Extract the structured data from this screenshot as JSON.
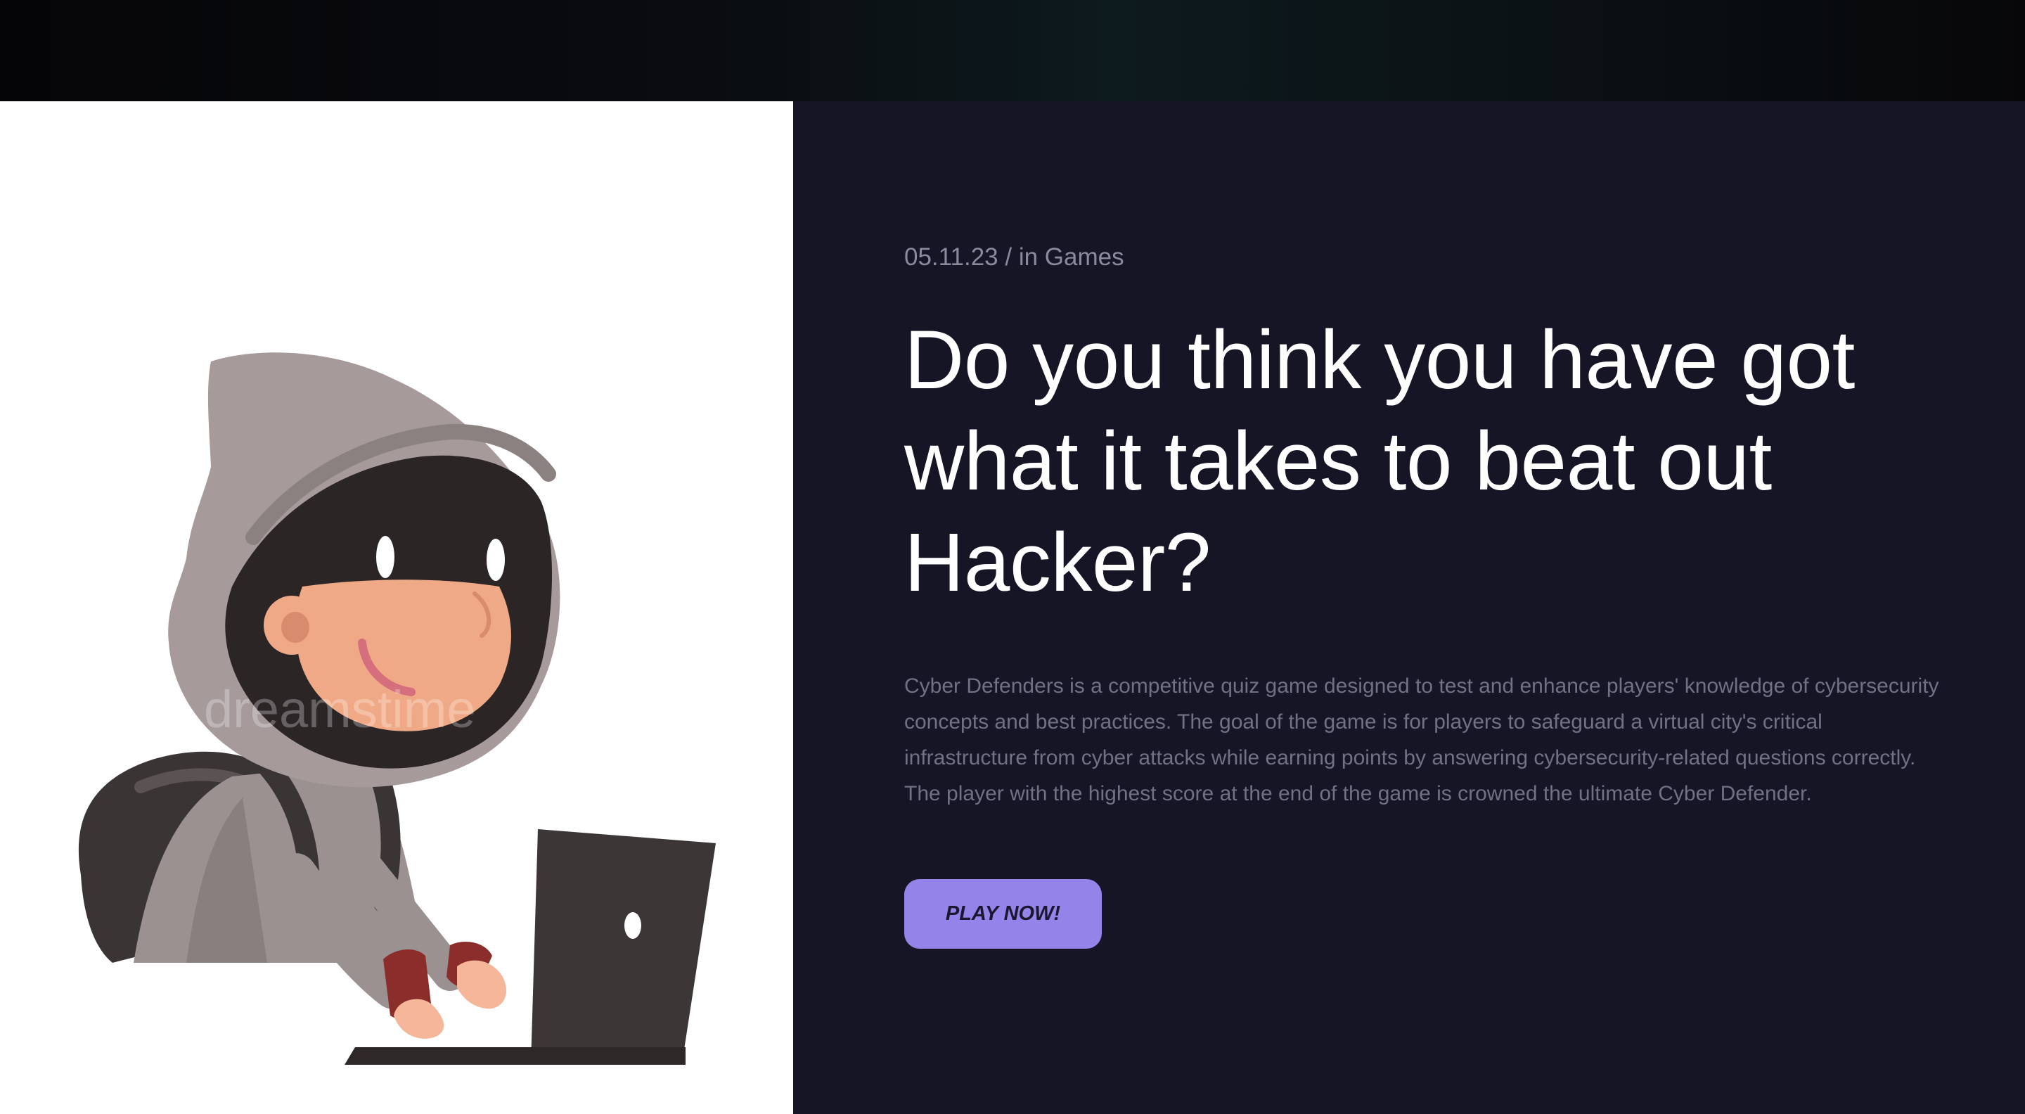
{
  "post": {
    "meta": "05.11.23 / in Games",
    "title": "Do you think you have got what it takes to beat out Hacker?",
    "description": "Cyber Defenders is a competitive quiz game designed to test and enhance players' knowledge of cybersecurity concepts and best practices. The goal of the game is for players to safeguard a virtual city's critical infrastructure from cyber attacks while earning points by answering cybersecurity-related questions correctly. The player with the highest score at the end of the game is crowned the ultimate Cyber Defender.",
    "cta_label": "PLAY NOW!"
  },
  "illustration": {
    "icon": "hacker-with-laptop-illustration",
    "watermark": "dreamstime"
  },
  "colors": {
    "background": "#161525",
    "accent": "#9483e8",
    "title": "#ffffff",
    "body_text": "#717084",
    "meta_text": "#8a8a9c"
  }
}
